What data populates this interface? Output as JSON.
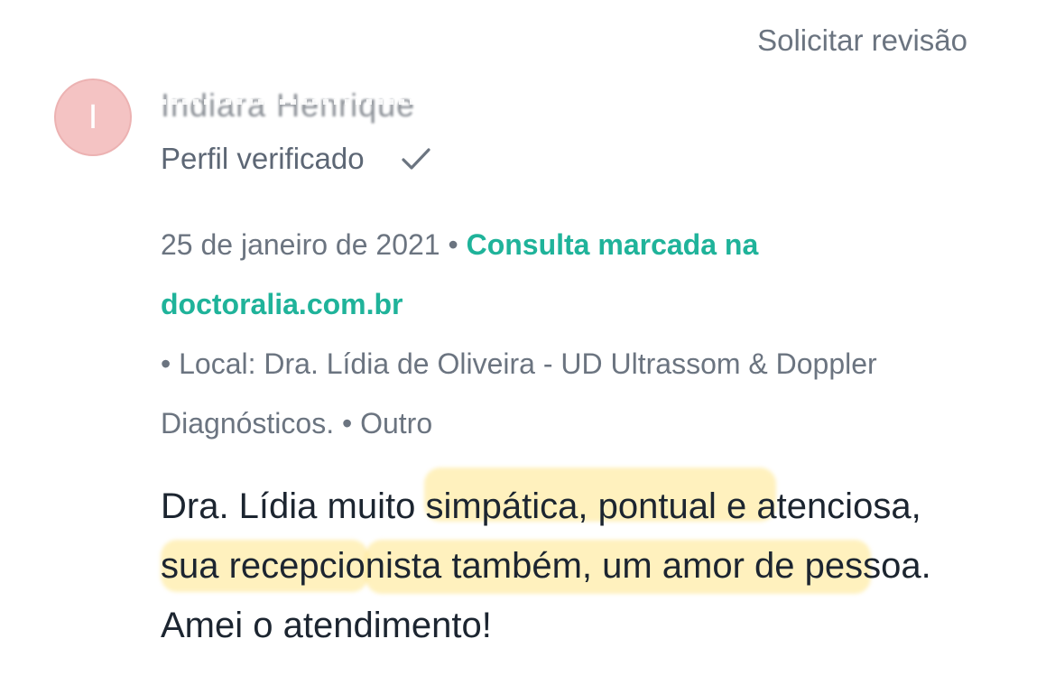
{
  "header": {
    "review_action": "Solicitar revisão"
  },
  "author": {
    "initial": "I",
    "name": "Indiara Henrique",
    "verified_label": "Perfil verificado",
    "verified_icon": "check-icon"
  },
  "meta": {
    "date": "25 de janeiro de 2021",
    "separator": " • ",
    "booking_source": "Consulta marcada na doctoralia.com.br",
    "location": "• Local: Dra. Lídia de Oliveira - UD Ultrassom & Doppler Diagnósticos.",
    "service": " • Outro"
  },
  "review": {
    "text": "Dra. Lídia muito simpática, pontual e atenciosa, sua recepcionista também, um amor de pessoa. Amei o atendimento!"
  },
  "colors": {
    "accent": "#1fb39a",
    "avatar_bg": "#f4c3c3",
    "highlight": "#ffde64",
    "muted_text": "#6b7480",
    "body_text": "#1c2530"
  }
}
